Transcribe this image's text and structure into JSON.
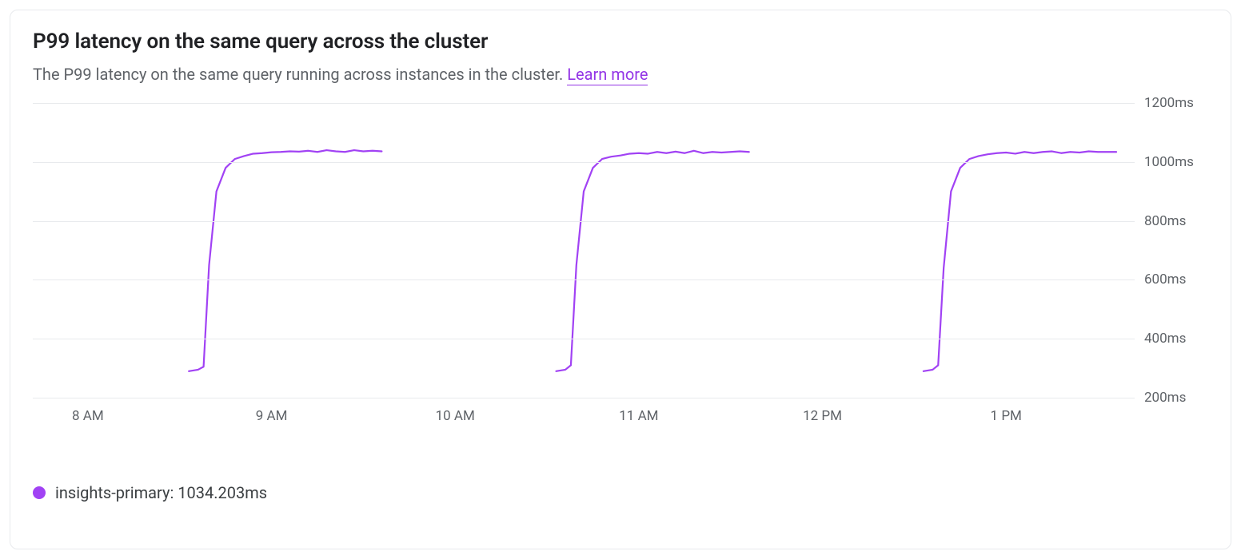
{
  "header": {
    "title": "P99 latency on the same query across the cluster",
    "subtitle_prefix": "The P99 latency on the same query running across instances in the cluster. ",
    "learn_more_label": "Learn more"
  },
  "legend": {
    "series_name": "insights-primary",
    "value_text": "1034.203ms"
  },
  "colors": {
    "series": "#a142f4",
    "grid": "#e8eaed",
    "axis_text": "#5f6368"
  },
  "chart_data": {
    "type": "line",
    "title": "P99 latency on the same query across the cluster",
    "xlabel": "",
    "ylabel": "",
    "ylim": [
      200,
      1200
    ],
    "x_ticks": [
      "8 AM",
      "9 AM",
      "10 AM",
      "11 AM",
      "12 PM",
      "1 PM"
    ],
    "y_ticks": [
      "200ms",
      "400ms",
      "600ms",
      "800ms",
      "1000ms",
      "1200ms"
    ],
    "series": [
      {
        "name": "insights-primary",
        "segments": [
          {
            "x": [
              8.55,
              8.6,
              8.63,
              8.66,
              8.7,
              8.75,
              8.8,
              8.85,
              8.9,
              8.95,
              9.0,
              9.05,
              9.1,
              9.15,
              9.2,
              9.25,
              9.3,
              9.35,
              9.4,
              9.45,
              9.5,
              9.55,
              9.6
            ],
            "y": [
              290,
              295,
              305,
              650,
              900,
              980,
              1010,
              1020,
              1028,
              1030,
              1033,
              1034,
              1036,
              1035,
              1038,
              1034,
              1040,
              1036,
              1034,
              1040,
              1036,
              1038,
              1036
            ]
          },
          {
            "x": [
              10.55,
              10.6,
              10.63,
              10.66,
              10.7,
              10.75,
              10.8,
              10.85,
              10.9,
              10.95,
              11.0,
              11.05,
              11.1,
              11.15,
              11.2,
              11.25,
              11.3,
              11.35,
              11.4,
              11.45,
              11.5,
              11.55,
              11.6
            ],
            "y": [
              290,
              295,
              310,
              650,
              900,
              980,
              1010,
              1018,
              1022,
              1028,
              1030,
              1028,
              1034,
              1030,
              1035,
              1030,
              1038,
              1030,
              1034,
              1032,
              1034,
              1036,
              1034
            ]
          },
          {
            "x": [
              12.55,
              12.6,
              12.63,
              12.66,
              12.7,
              12.75,
              12.8,
              12.85,
              12.9,
              12.95,
              13.0,
              13.05,
              13.1,
              13.15,
              13.2,
              13.25,
              13.3,
              13.35,
              13.4,
              13.45,
              13.5,
              13.55,
              13.6
            ],
            "y": [
              290,
              295,
              310,
              640,
              900,
              980,
              1010,
              1020,
              1026,
              1030,
              1032,
              1028,
              1034,
              1030,
              1034,
              1036,
              1030,
              1034,
              1032,
              1036,
              1034,
              1034,
              1034
            ]
          }
        ]
      }
    ],
    "x_domain": [
      7.7,
      13.7
    ]
  }
}
